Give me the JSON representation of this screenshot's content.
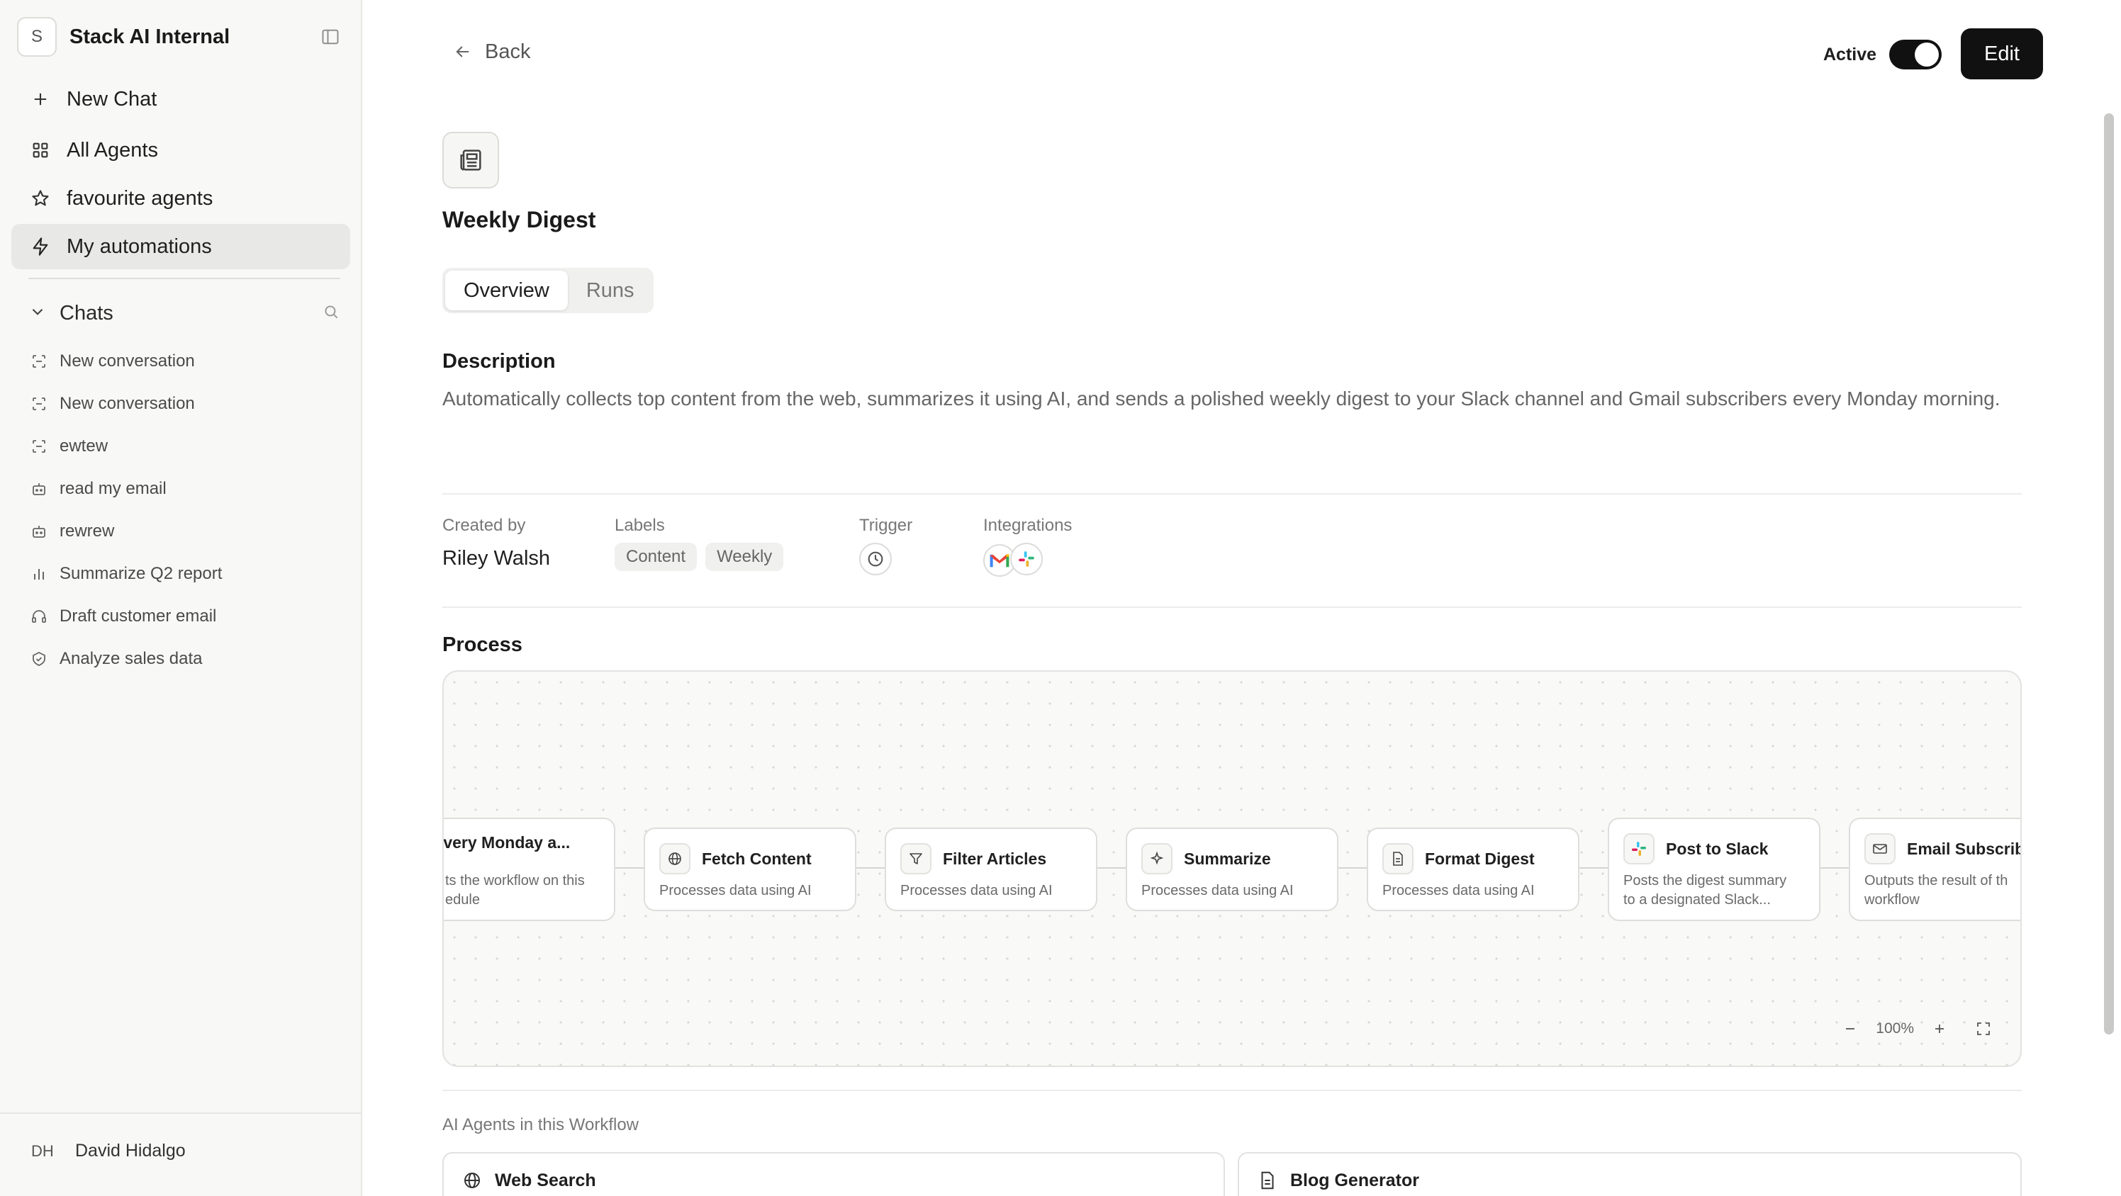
{
  "workspace": {
    "initial": "S",
    "name": "Stack AI Internal"
  },
  "nav": {
    "new_chat": "New Chat",
    "all_agents": "All Agents",
    "favourites": "favourite agents",
    "automations": "My automations"
  },
  "chats": {
    "header": "Chats",
    "items": [
      {
        "label": "New conversation",
        "icon": "chat-scan-icon"
      },
      {
        "label": "New conversation",
        "icon": "chat-scan-icon"
      },
      {
        "label": "ewtew",
        "icon": "chat-scan-icon"
      },
      {
        "label": "read my email",
        "icon": "bot-icon"
      },
      {
        "label": "rewrew",
        "icon": "bot-icon"
      },
      {
        "label": "Summarize Q2 report",
        "icon": "bar-chart-icon"
      },
      {
        "label": "Draft customer email",
        "icon": "headset-icon"
      },
      {
        "label": "Analyze sales data",
        "icon": "badge-icon"
      }
    ]
  },
  "user": {
    "initials": "DH",
    "name": "David Hidalgo"
  },
  "header": {
    "back": "Back",
    "active_label": "Active",
    "active": true,
    "edit": "Edit"
  },
  "agent": {
    "title": "Weekly Digest",
    "tabs": [
      "Overview",
      "Runs"
    ],
    "active_tab": "Overview",
    "description_heading": "Description",
    "description": "Automatically collects top content from the web, summarizes it using AI, and sends a polished weekly digest to your Slack channel and Gmail subscribers every Monday morning."
  },
  "meta": {
    "created_by_label": "Created by",
    "created_by": "Riley Walsh",
    "labels_label": "Labels",
    "labels": [
      "Content",
      "Weekly"
    ],
    "trigger_label": "Trigger",
    "trigger_icon": "clock-icon",
    "integrations_label": "Integrations",
    "integrations": [
      "gmail-icon",
      "slack-icon"
    ]
  },
  "process": {
    "heading": "Process",
    "zoom": "100%",
    "nodes": [
      {
        "title": "Every Monday a...",
        "desc": [
          "ts the workflow on this",
          "edule"
        ],
        "icon": "clock-icon"
      },
      {
        "title": "Fetch Content",
        "desc": [
          "Processes data using AI"
        ],
        "icon": "globe-icon"
      },
      {
        "title": "Filter Articles",
        "desc": [
          "Processes data using AI"
        ],
        "icon": "filter-icon"
      },
      {
        "title": "Summarize",
        "desc": [
          "Processes data using AI"
        ],
        "icon": "sparkle-icon"
      },
      {
        "title": "Format Digest",
        "desc": [
          "Processes data using AI"
        ],
        "icon": "document-icon"
      },
      {
        "title": "Post to Slack",
        "desc": [
          "Posts the digest summary",
          "to a designated Slack..."
        ],
        "icon": "slack-icon"
      },
      {
        "title": "Email Subscrib",
        "desc": [
          "Outputs the result of th",
          "workflow"
        ],
        "icon": "mail-icon"
      }
    ]
  },
  "agents_section": {
    "heading": "AI Agents in this Workflow",
    "items": [
      {
        "title": "Web Search",
        "icon": "globe-icon"
      },
      {
        "title": "Blog Generator",
        "icon": "document-icon"
      }
    ]
  }
}
